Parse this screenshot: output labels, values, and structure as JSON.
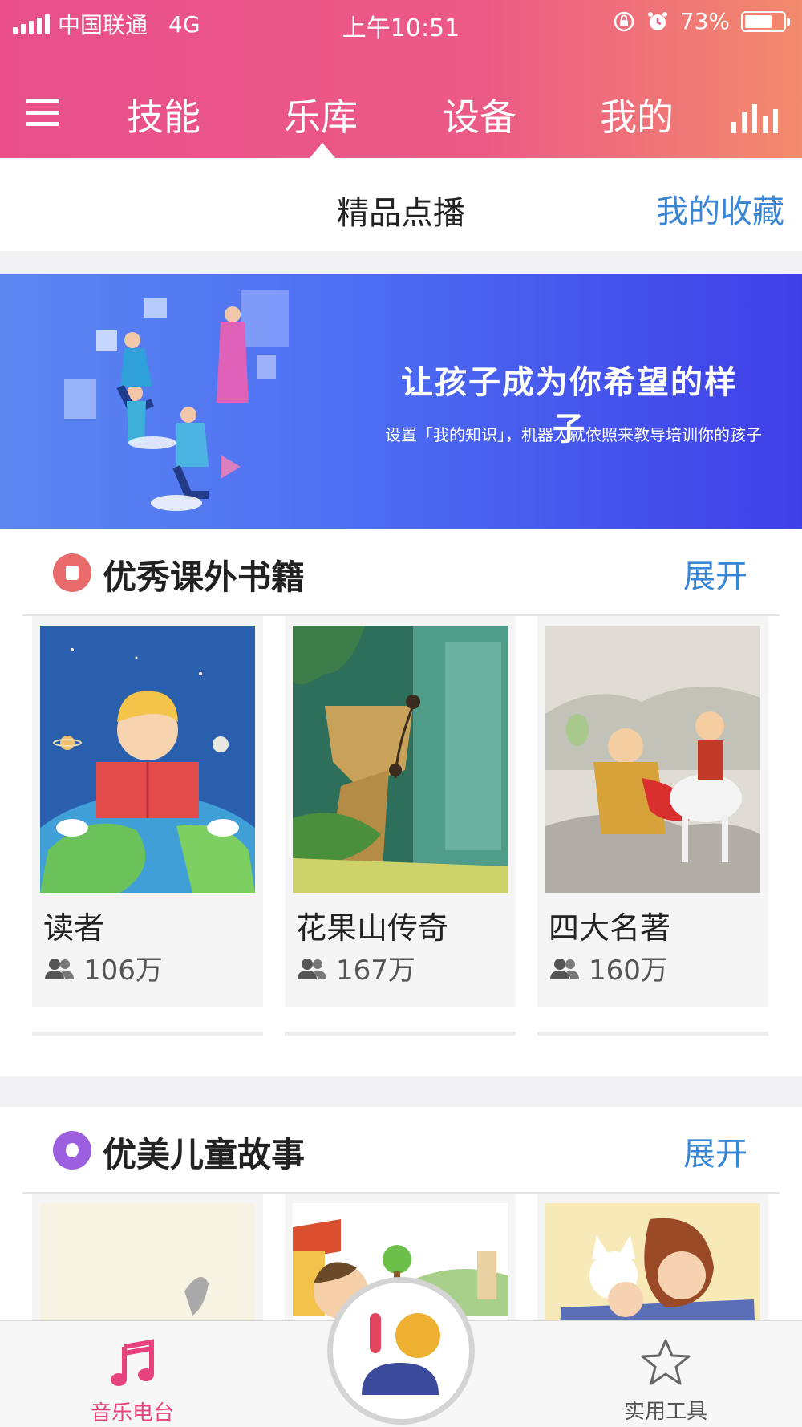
{
  "status_bar": {
    "carrier": "中国联通",
    "network": "4G",
    "time": "上午10:51",
    "battery": "73%",
    "battery_level": 0.73
  },
  "nav": {
    "tabs": [
      "技能",
      "乐库",
      "设备",
      "我的"
    ],
    "active_tab": "乐库"
  },
  "subbar": {
    "title": "精品点播",
    "favorites": "我的收藏"
  },
  "banner": {
    "headline": "让孩子成为你希望的样子",
    "subtext": "设置「我的知识」，机器人就依照来教导培训你的孩子"
  },
  "sections": [
    {
      "title": "优秀课外书籍",
      "more": "展开",
      "icon_color": "#e86a6a",
      "items": [
        {
          "name": "读者",
          "count": "106万"
        },
        {
          "name": "花果山传奇",
          "count": "167万"
        },
        {
          "name": "四大名著",
          "count": "160万"
        }
      ]
    },
    {
      "title": "优美儿童故事",
      "more": "展开",
      "icon_color": "#9b5fe0"
    }
  ],
  "tabbar": {
    "left_label": "音乐电台",
    "right_label": "实用工具"
  },
  "colors": {
    "accent": "#e8427c",
    "link": "#3a86d6"
  }
}
